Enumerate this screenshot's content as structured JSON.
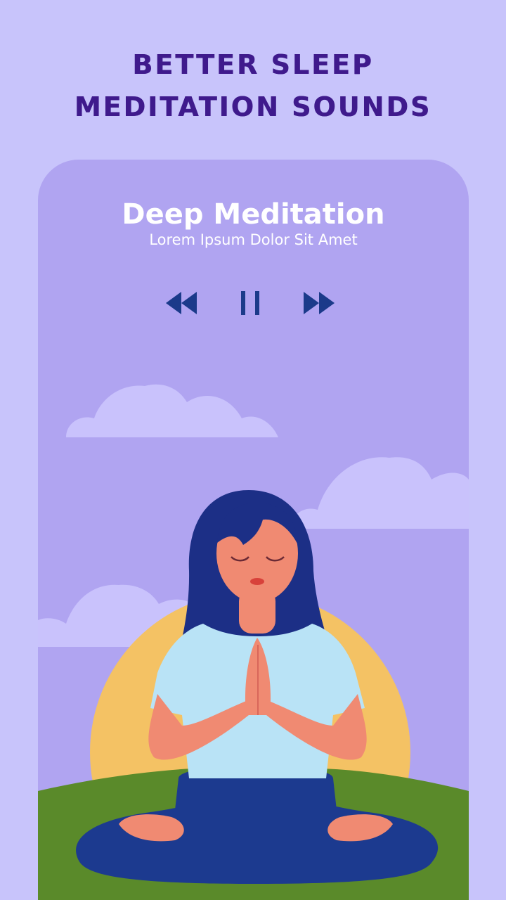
{
  "header": {
    "line1": "BETTER SLEEP",
    "line2": "MEDITATION SOUNDS"
  },
  "player": {
    "title": "Deep Meditation",
    "subtitle": "Lorem Ipsum Dolor Sit Amet",
    "controls": {
      "previous_icon": "rewind-icon",
      "play_pause_icon": "pause-icon",
      "next_icon": "fast-forward-icon"
    }
  },
  "colors": {
    "background": "#c8c4fb",
    "card": "#b0a4f1",
    "headline": "#3f1a8c",
    "controls": "#1b3a8a",
    "sun": "#f4c264",
    "hill": "#5a8a2a",
    "hair": "#1c2f86",
    "shirt": "#b9e3f6",
    "skin": "#f08a72",
    "pants": "#1c3a8f",
    "cloud": "#c9c2fc"
  }
}
